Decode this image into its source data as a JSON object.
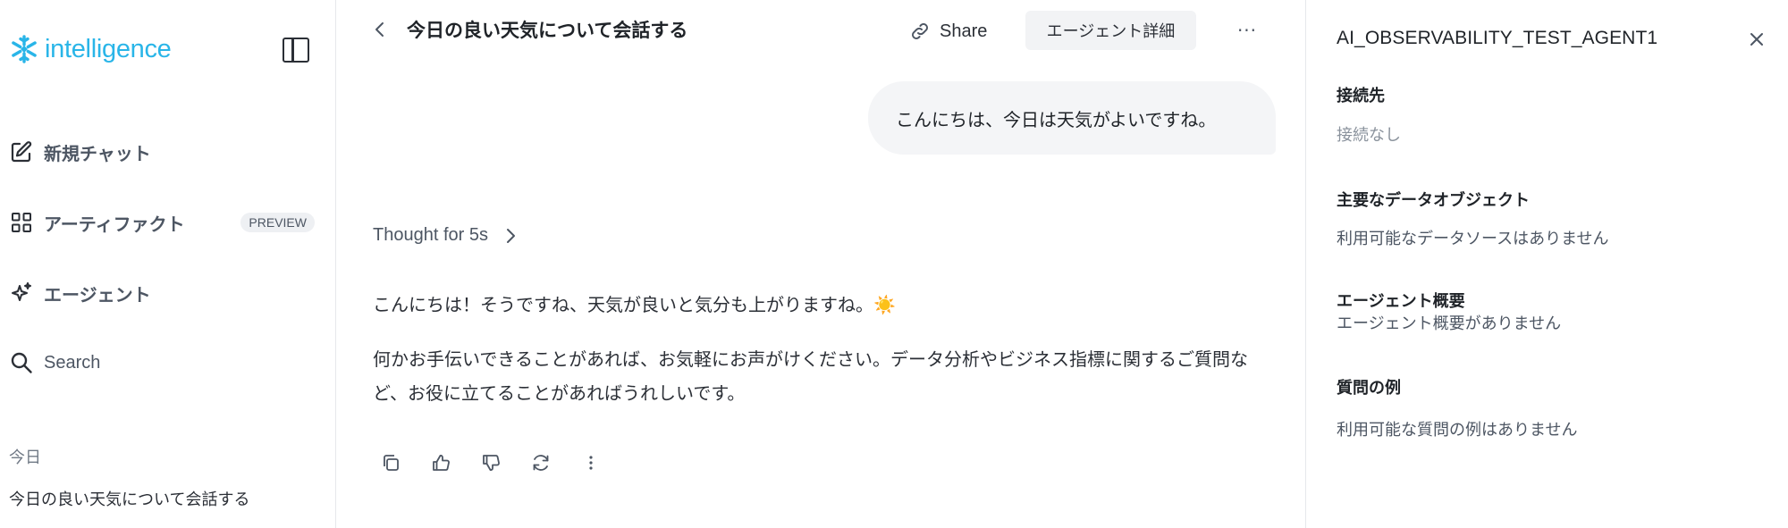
{
  "brand": {
    "name": "intelligence",
    "color": "#29b5e8",
    "icon": "snowflake-icon"
  },
  "sidebar": {
    "items": [
      {
        "label": "新規チャット",
        "icon": "edit-icon"
      },
      {
        "label": "アーティファクト",
        "icon": "grid-icon",
        "badge": "PREVIEW"
      },
      {
        "label": "エージェント",
        "icon": "sparkle-icon"
      },
      {
        "label": "Search",
        "icon": "search-icon"
      }
    ],
    "history_section": "今日",
    "history_items": [
      "今日の良い天気について会話する"
    ]
  },
  "header": {
    "title": "今日の良い天気について会話する",
    "share_label": "Share",
    "agent_details_label": "エージェント詳細",
    "more_label": "···"
  },
  "chat": {
    "user_message": "こんにちは、今日は天気がよいですね。",
    "thought_label": "Thought for 5s",
    "reply_paragraphs": [
      "こんにちは！そうですね、天気が良いと気分も上がりますね。☀️",
      "何かお手伝いできることがあれば、お気軽にお声がけください。データ分析やビジネス指標に関するご質問など、お役に立てることがあればうれしいです。"
    ],
    "actions": [
      "copy-icon",
      "thumbs-up-icon",
      "thumbs-down-icon",
      "regenerate-icon",
      "more-vertical-icon"
    ]
  },
  "panel": {
    "title": "AI_OBSERVABILITY_TEST_AGENT1",
    "sections": [
      {
        "heading": "接続先",
        "value": "接続なし"
      },
      {
        "heading": "主要なデータオブジェクト",
        "value": "利用可能なデータソースはありません"
      },
      {
        "heading": "エージェント概要",
        "value": "エージェント概要がありません"
      },
      {
        "heading": "質問の例",
        "value": "利用可能な質問の例はありません"
      }
    ]
  }
}
